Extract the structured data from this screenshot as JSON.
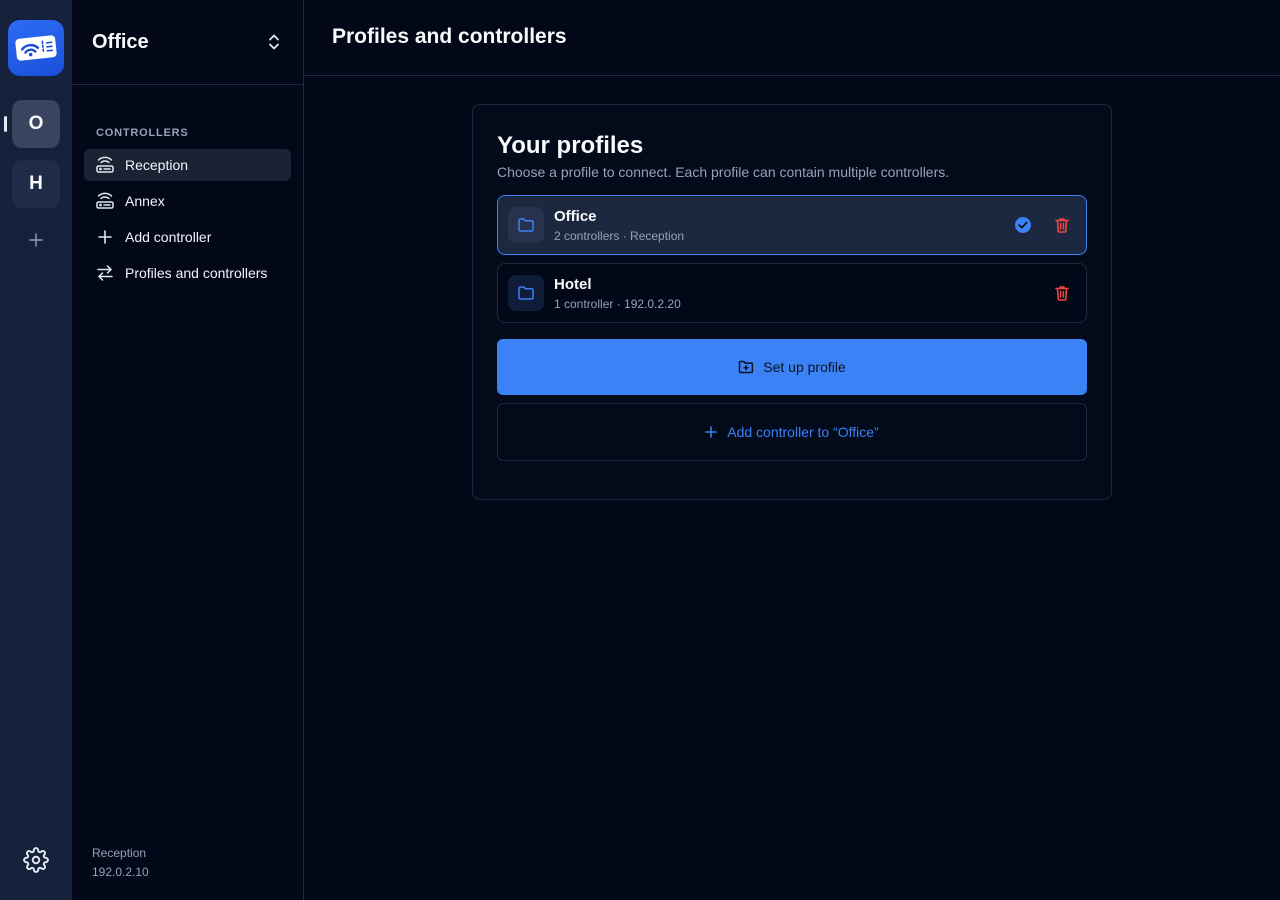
{
  "rail": {
    "profiles": [
      {
        "initial": "O",
        "active": true
      },
      {
        "initial": "H",
        "active": false
      }
    ]
  },
  "sidebar": {
    "title": "Office",
    "section_label": "CONTROLLERS",
    "items": [
      {
        "label": "Reception",
        "icon": "router-icon",
        "active": true
      },
      {
        "label": "Annex",
        "icon": "router-icon",
        "active": false
      },
      {
        "label": "Add controller",
        "icon": "plus-icon",
        "active": false
      },
      {
        "label": "Profiles and controllers",
        "icon": "swap-icon",
        "active": false
      }
    ],
    "footer": {
      "name": "Reception",
      "ip": "192.0.2.10"
    }
  },
  "header": {
    "title": "Profiles and controllers"
  },
  "card": {
    "title": "Your profiles",
    "subtitle": "Choose a profile to connect. Each profile can contain multiple controllers.",
    "profiles": [
      {
        "name": "Office",
        "meta": "2 controllers · Reception",
        "selected": true
      },
      {
        "name": "Hotel",
        "meta": "1 controller · 192.0.2.20",
        "selected": false
      }
    ],
    "setup_button": "Set up profile",
    "add_controller_button": "Add controller to “Office”"
  },
  "colors": {
    "accent": "#3b82f6",
    "danger": "#ef4444",
    "background": "#020817",
    "rail": "#16213c"
  }
}
